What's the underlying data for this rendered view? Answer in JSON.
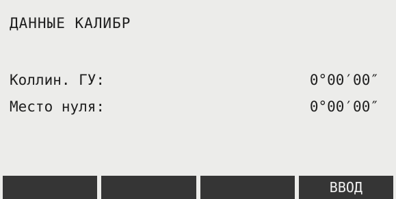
{
  "screen": {
    "title": "ДАННЫЕ КАЛИБР"
  },
  "params": [
    {
      "label": "Коллин. ГУ:",
      "value": "0°00′00″"
    },
    {
      "label": "Место нуля:",
      "value": "0°00′00″"
    }
  ],
  "softkeys": [
    {
      "label": ""
    },
    {
      "label": ""
    },
    {
      "label": ""
    },
    {
      "label": "ВВОД"
    }
  ]
}
